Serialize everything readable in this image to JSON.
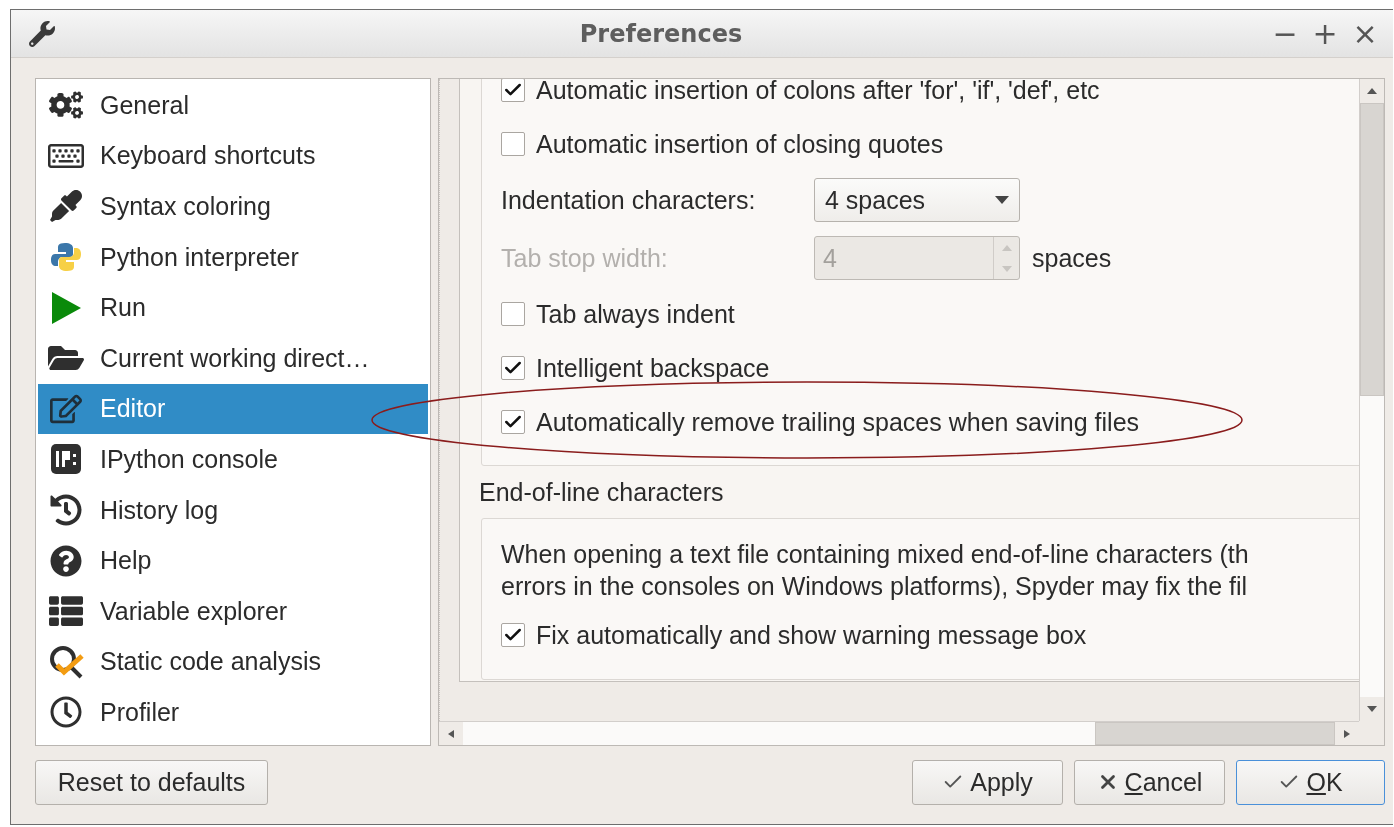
{
  "window": {
    "title": "Preferences",
    "controls": [
      "−",
      "+",
      "×"
    ]
  },
  "sidebar": {
    "items": [
      {
        "label": "General",
        "selected": false
      },
      {
        "label": "Keyboard shortcuts",
        "selected": false
      },
      {
        "label": "Syntax coloring",
        "selected": false
      },
      {
        "label": "Python interpreter",
        "selected": false
      },
      {
        "label": "Run",
        "selected": false
      },
      {
        "label": "Current working direct…",
        "selected": false
      },
      {
        "label": "Editor",
        "selected": true
      },
      {
        "label": "IPython console",
        "selected": false
      },
      {
        "label": "History log",
        "selected": false
      },
      {
        "label": "Help",
        "selected": false
      },
      {
        "label": "Variable explorer",
        "selected": false
      },
      {
        "label": "Static code analysis",
        "selected": false
      },
      {
        "label": "Profiler",
        "selected": false
      }
    ]
  },
  "editor": {
    "rows": [
      {
        "kind": "checkbox",
        "label": "Automatic insertion of colons after 'for', 'if', 'def', etc",
        "checked": true
      },
      {
        "kind": "checkbox",
        "label": "Automatic insertion of closing quotes",
        "checked": false
      },
      {
        "kind": "combo",
        "label": "Indentation characters:",
        "value": "4 spaces",
        "disabled": false
      },
      {
        "kind": "spin",
        "label": "Tab stop width:",
        "value": "4",
        "suffix": "spaces",
        "disabled": true
      },
      {
        "kind": "checkbox",
        "label": "Tab always indent",
        "checked": false
      },
      {
        "kind": "checkbox",
        "label": "Intelligent backspace",
        "checked": true
      },
      {
        "kind": "checkbox",
        "label": "Automatically remove trailing spaces when saving files",
        "checked": true
      }
    ]
  },
  "eol_group": {
    "title": "End-of-line characters",
    "description": [
      "When opening a text file containing mixed end-of-line characters (th",
      "errors in the consoles on Windows platforms), Spyder may fix the fil"
    ],
    "option": {
      "label": "Fix automatically and show warning message box",
      "checked": true
    }
  },
  "buttons": {
    "reset": "Reset to defaults",
    "actions": [
      {
        "kind": "apply",
        "label": "Apply",
        "mnemonic": false,
        "default": false
      },
      {
        "kind": "cancel",
        "label": "Cancel",
        "mnemonic": true,
        "default": false
      },
      {
        "kind": "ok",
        "label": "OK",
        "mnemonic": true,
        "default": true
      }
    ]
  },
  "annotation": {
    "kind": "ellipse"
  }
}
